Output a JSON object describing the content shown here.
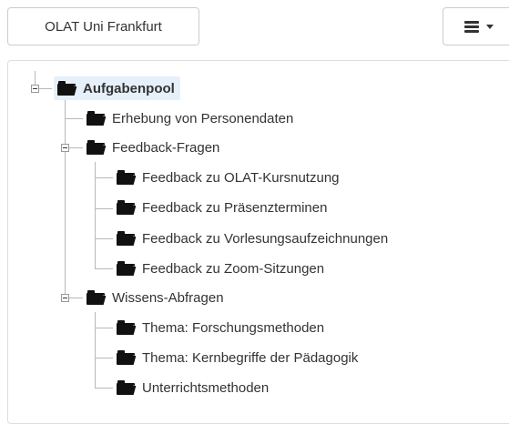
{
  "header": {
    "root_button_label": "OLAT Uni Frankfurt",
    "menu_icon": "hamburger-menu-icon",
    "menu_caret_icon": "caret-down-icon"
  },
  "tree": {
    "root": {
      "label": "Aufgabenpool",
      "selected": true,
      "icon": "folder-open-icon"
    },
    "nodes": [
      {
        "label": "Erhebung von Personendaten",
        "icon": "folder-open-icon"
      },
      {
        "label": "Feedback-Fragen",
        "icon": "folder-open-icon",
        "expanded": true,
        "children": [
          {
            "label": "Feedback zu OLAT-Kursnutzung"
          },
          {
            "label": "Feedback zu Präsenzterminen"
          },
          {
            "label": "Feedback zu Vorlesungsaufzeichnungen"
          },
          {
            "label": "Feedback zu Zoom-Sitzungen"
          }
        ]
      },
      {
        "label": "Wissens-Abfragen",
        "icon": "folder-open-icon",
        "expanded": true,
        "children": [
          {
            "label": "Thema: Forschungsmethoden"
          },
          {
            "label": "Thema: Kernbegriffe der Pädagogik"
          },
          {
            "label": "Unterrichtsmethoden"
          }
        ]
      }
    ]
  },
  "colors": {
    "selected_bg": "#e5f0fa",
    "border": "#dddddd",
    "tree_line": "#b8b8b8"
  }
}
